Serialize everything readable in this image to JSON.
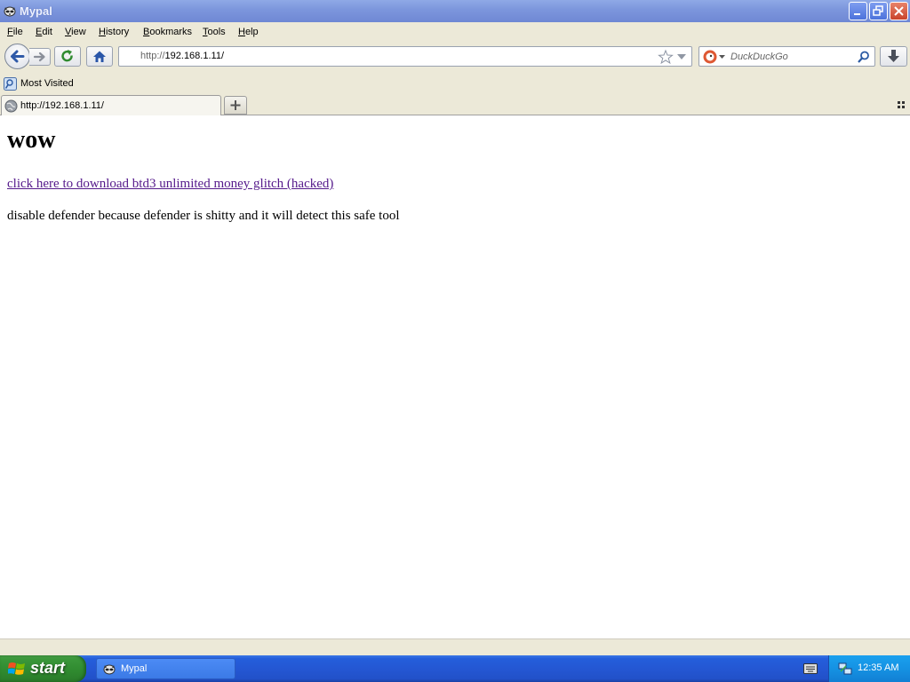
{
  "window": {
    "title": "Mypal"
  },
  "menu": [
    {
      "label": "File",
      "key": "F",
      "rest": "ile"
    },
    {
      "label": "Edit",
      "key": "E",
      "rest": "dit"
    },
    {
      "label": "View",
      "key": "V",
      "rest": "iew"
    },
    {
      "label": "History",
      "key": "H",
      "rest": "istory"
    },
    {
      "label": "Bookmarks",
      "key": "B",
      "rest": "ookmarks"
    },
    {
      "label": "Tools",
      "key": "T",
      "rest": "ools"
    },
    {
      "label": "Help",
      "key": "H",
      "rest": "elp"
    }
  ],
  "navbar": {
    "url_scheme": "http://",
    "url_host": "192.168.1.11/",
    "search_placeholder": "DuckDuckGo"
  },
  "bookmarks": {
    "most_visited": "Most Visited"
  },
  "tab": {
    "label": "http://192.168.1.11/"
  },
  "page": {
    "heading": "wow",
    "link": "click here to download btd3 unlimited money glitch (hacked)",
    "note": "disable defender because defender is shitty and it will detect this safe tool"
  },
  "taskbar": {
    "start_label": "start",
    "task_label": "Mypal",
    "clock": "12:35 AM"
  },
  "colors": {
    "titlebar": "#7D97DD",
    "chrome": "#ECE9D8",
    "visited_link": "#551A8B",
    "taskbar": "#245EDB",
    "start": "#3A973A"
  }
}
